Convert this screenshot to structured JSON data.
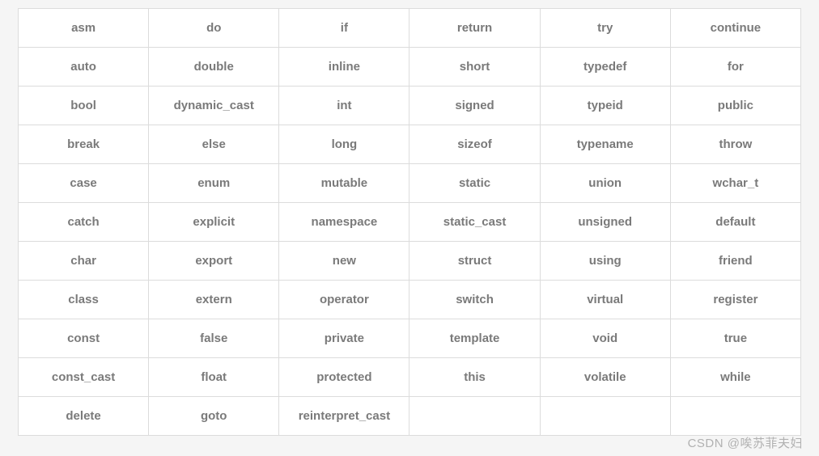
{
  "chart_data": {
    "type": "table",
    "title": "",
    "rows": [
      [
        "asm",
        "do",
        "if",
        "return",
        "try",
        "continue"
      ],
      [
        "auto",
        "double",
        "inline",
        "short",
        "typedef",
        "for"
      ],
      [
        "bool",
        "dynamic_cast",
        "int",
        "signed",
        "typeid",
        "public"
      ],
      [
        "break",
        "else",
        "long",
        "sizeof",
        "typename",
        "throw"
      ],
      [
        "case",
        "enum",
        "mutable",
        "static",
        "union",
        "wchar_t"
      ],
      [
        "catch",
        "explicit",
        "namespace",
        "static_cast",
        "unsigned",
        "default"
      ],
      [
        "char",
        "export",
        "new",
        "struct",
        "using",
        "friend"
      ],
      [
        "class",
        "extern",
        "operator",
        "switch",
        "virtual",
        "register"
      ],
      [
        "const",
        "false",
        "private",
        "template",
        "void",
        "true"
      ],
      [
        "const_cast",
        "float",
        "protected",
        "this",
        "volatile",
        "while"
      ],
      [
        "delete",
        "goto",
        "reinterpret_cast",
        "",
        "",
        ""
      ]
    ]
  },
  "watermark": "CSDN @唉苏菲夫妇"
}
